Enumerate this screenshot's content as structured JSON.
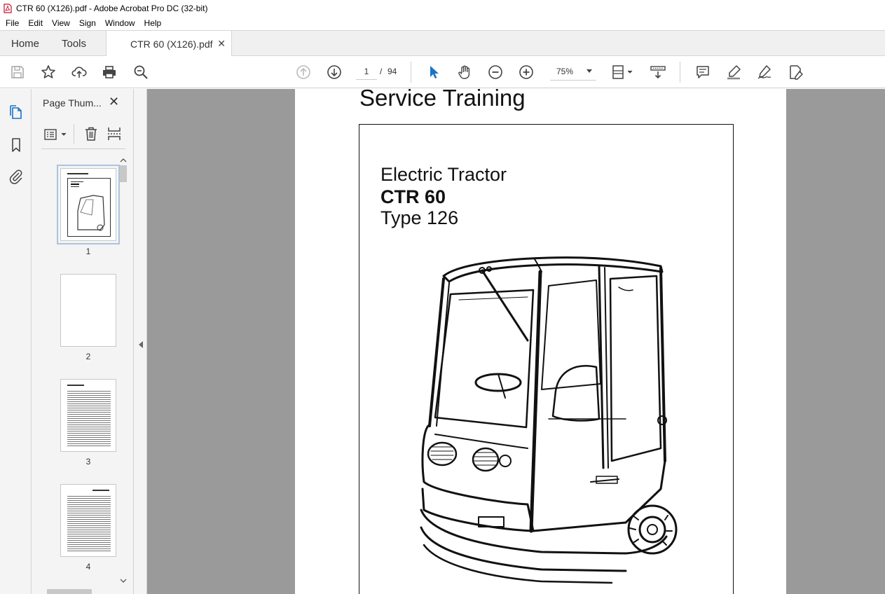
{
  "window": {
    "title": "CTR 60 (X126).pdf - Adobe Acrobat Pro DC (32-bit)"
  },
  "menu": [
    "File",
    "Edit",
    "View",
    "Sign",
    "Window",
    "Help"
  ],
  "tabs": {
    "home": "Home",
    "tools": "Tools",
    "document": "CTR 60 (X126).pdf"
  },
  "toolbar": {
    "current_page": "1",
    "page_separator": "/",
    "total_pages": "94",
    "zoom": "75%"
  },
  "panel": {
    "title": "Page Thum...",
    "thumbnails": [
      "1",
      "2",
      "3",
      "4"
    ]
  },
  "document": {
    "heading": "Service Training",
    "line1": "Electric Tractor",
    "line2": "CTR 60",
    "line3": "Type 126"
  },
  "colors": {
    "accent_blue": "#1a73c7",
    "doc_background": "#9a9a9a",
    "pdf_red": "#c8102e"
  }
}
